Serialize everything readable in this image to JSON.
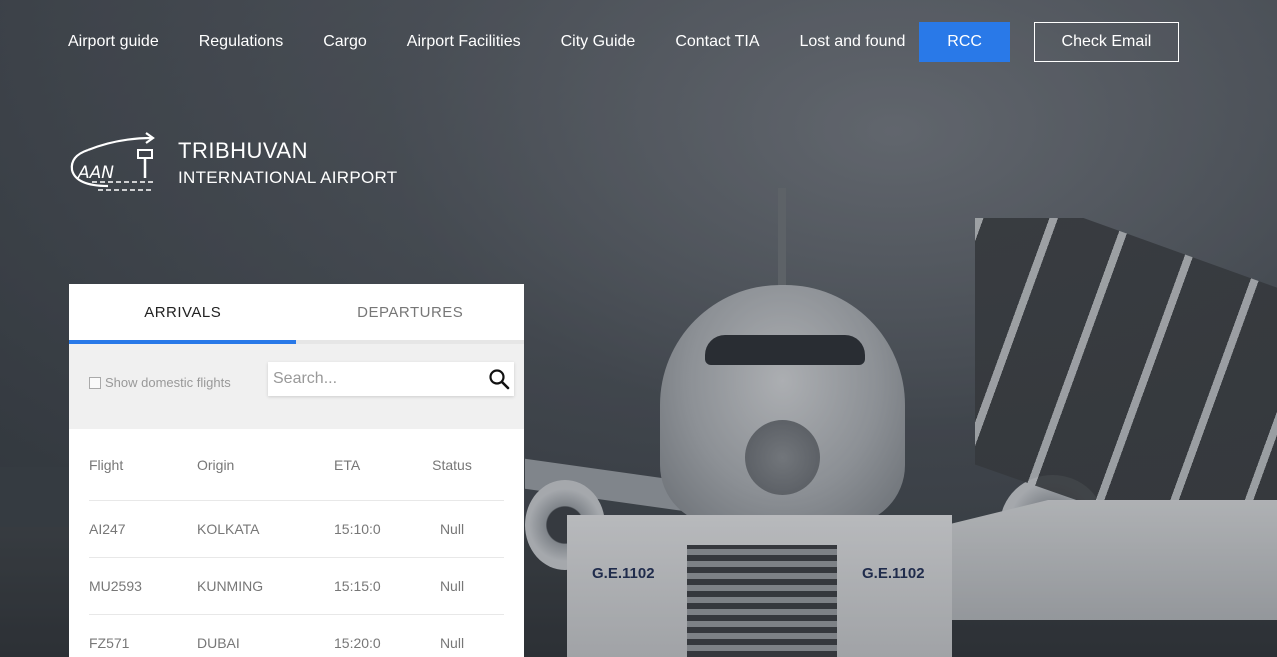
{
  "nav": {
    "items": [
      {
        "label": "Airport guide"
      },
      {
        "label": "Regulations"
      },
      {
        "label": "Cargo"
      },
      {
        "label": "Airport Facilities"
      },
      {
        "label": "City Guide"
      },
      {
        "label": "Contact TIA"
      },
      {
        "label": "Lost and found"
      }
    ],
    "rcc_label": "RCC",
    "email_label": "Check Email"
  },
  "logo": {
    "mark_text": "AAN",
    "title_line1": "TRIBHUVAN",
    "title_line2": "INTERNATIONAL AIRPORT"
  },
  "background": {
    "vehicle_label_left": "G.E.1102",
    "vehicle_label_right": "G.E.1102"
  },
  "flights": {
    "tabs": [
      {
        "label": "ARRIVALS",
        "active": true
      },
      {
        "label": "DEPARTURES",
        "active": false
      }
    ],
    "domestic_label": "Show domestic flights",
    "search_placeholder": "Search...",
    "columns": [
      "Flight",
      "Origin",
      "ETA",
      "Status"
    ],
    "rows": [
      {
        "flight": "AI247",
        "origin": "KOLKATA",
        "eta": "15:10:0",
        "status": "Null"
      },
      {
        "flight": "MU2593",
        "origin": "KUNMING",
        "eta": "15:15:0",
        "status": "Null"
      },
      {
        "flight": "FZ571",
        "origin": "DUBAI",
        "eta": "15:20:0",
        "status": "Null"
      }
    ]
  },
  "colors": {
    "accent": "#2979e8",
    "panel_bg": "#ffffff",
    "filter_bg": "#f0f0f0"
  }
}
